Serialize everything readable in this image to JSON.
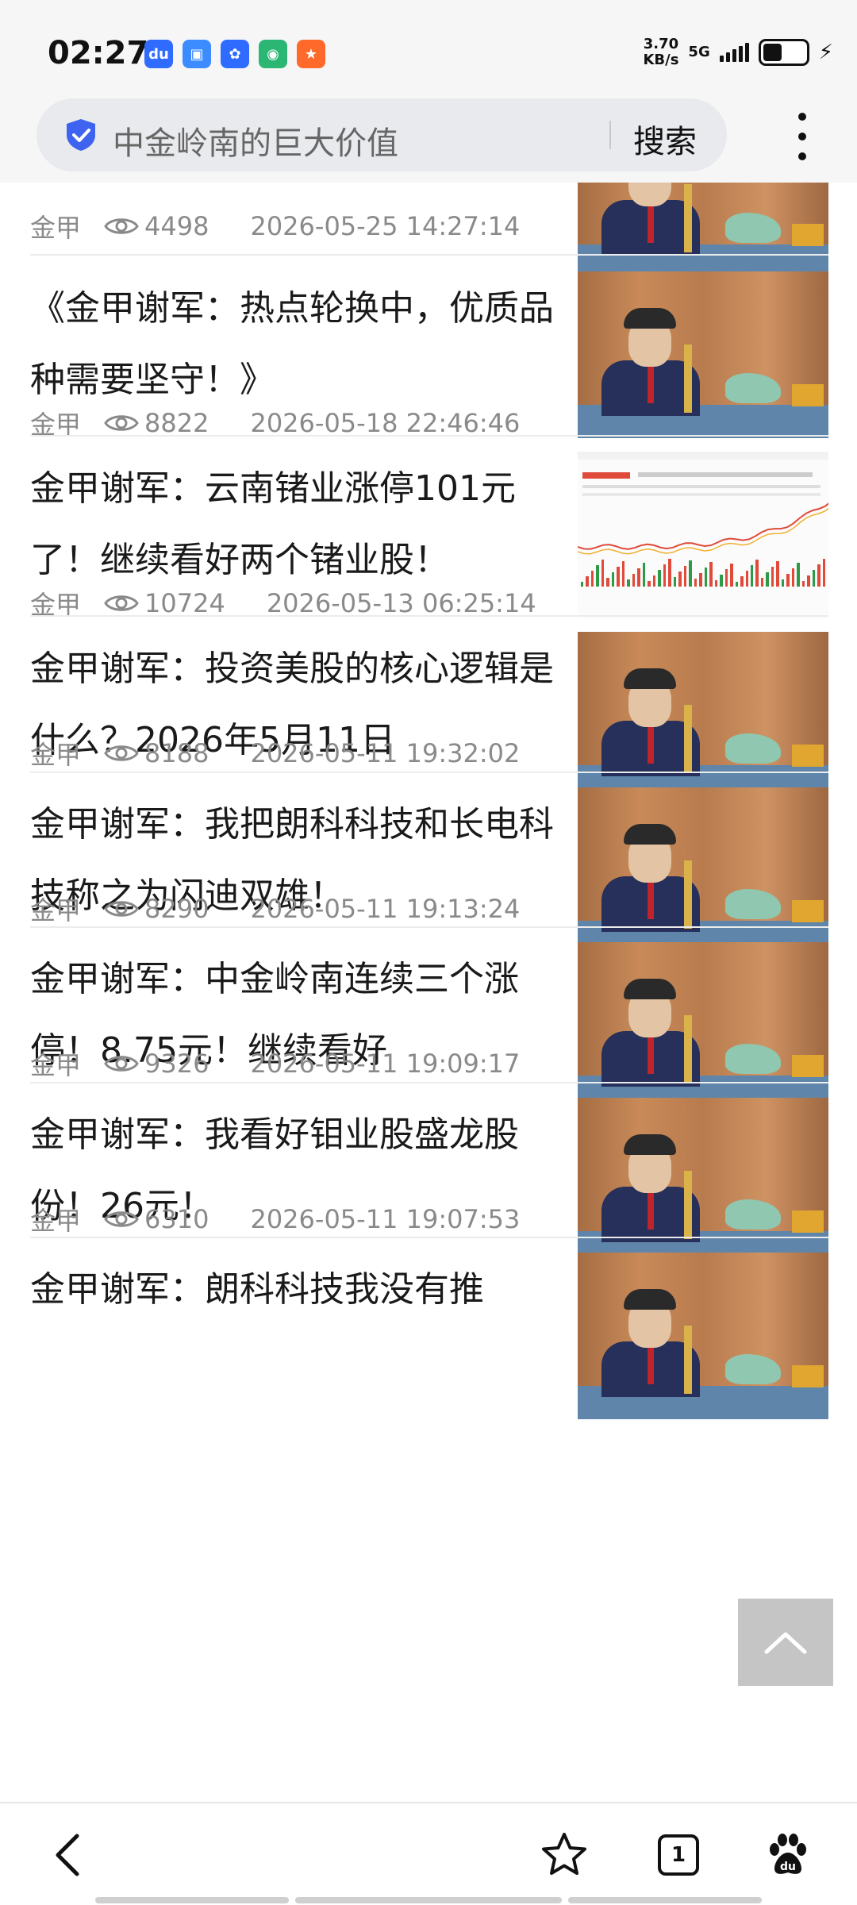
{
  "status_bar": {
    "time": "02:27",
    "net_speed_value": "3.70",
    "net_speed_unit": "KB/s",
    "network": "5G",
    "battery_percent": 45,
    "app_icons": [
      {
        "name": "baidu-app-icon",
        "glyph": "du",
        "color": "#2f6bff"
      },
      {
        "name": "files-app-icon",
        "glyph": "▣",
        "color": "#3c8cff"
      },
      {
        "name": "baidu-paw-icon",
        "glyph": "✿",
        "color": "#2f6bff"
      },
      {
        "name": "browser-app-icon",
        "glyph": "◉",
        "color": "#2bb673"
      },
      {
        "name": "fitness-app-icon",
        "glyph": "★",
        "color": "#ff6a2b"
      }
    ]
  },
  "search": {
    "query": "中金岭南的巨大价值",
    "button_label": "搜索"
  },
  "feed": {
    "items": [
      {
        "title": "",
        "author": "金甲",
        "views": "4498",
        "date": "2026-05-25 14:27:14",
        "thumb": "studio"
      },
      {
        "title": "《金甲谢军：热点轮换中，优质品种需要坚守！》",
        "author": "金甲",
        "views": "8822",
        "date": "2026-05-18 22:46:46",
        "thumb": "studio"
      },
      {
        "title": "金甲谢军：云南锗业涨停101元了！继续看好两个锗业股！",
        "author": "金甲",
        "views": "10724",
        "date": "2026-05-13 06:25:14",
        "thumb": "chart"
      },
      {
        "title": "金甲谢军：投资美股的核心逻辑是什么？2026年5月11日",
        "author": "金甲",
        "views": "8188",
        "date": "2026-05-11 19:32:02",
        "thumb": "studio"
      },
      {
        "title": "  金甲谢军：我把朗科科技和长电科技称之为闪迪双雄！",
        "author": "金甲",
        "views": "8290",
        "date": "2026-05-11 19:13:24",
        "thumb": "studio"
      },
      {
        "title": "金甲谢军：中金岭南连续三个涨停！8.75元！继续看好",
        "author": "金甲",
        "views": "9326",
        "date": "2026-05-11 19:09:17",
        "thumb": "studio"
      },
      {
        "title": "金甲谢军：我看好钼业股盛龙股份！26元！",
        "author": "金甲",
        "views": "6310",
        "date": "2026-05-11 19:07:53",
        "thumb": "studio"
      },
      {
        "title": "金甲谢军：朗科科技我没有推",
        "author": "",
        "views": "",
        "date": "",
        "thumb": "studio"
      }
    ]
  },
  "bottom_nav": {
    "tab_count": "1"
  }
}
